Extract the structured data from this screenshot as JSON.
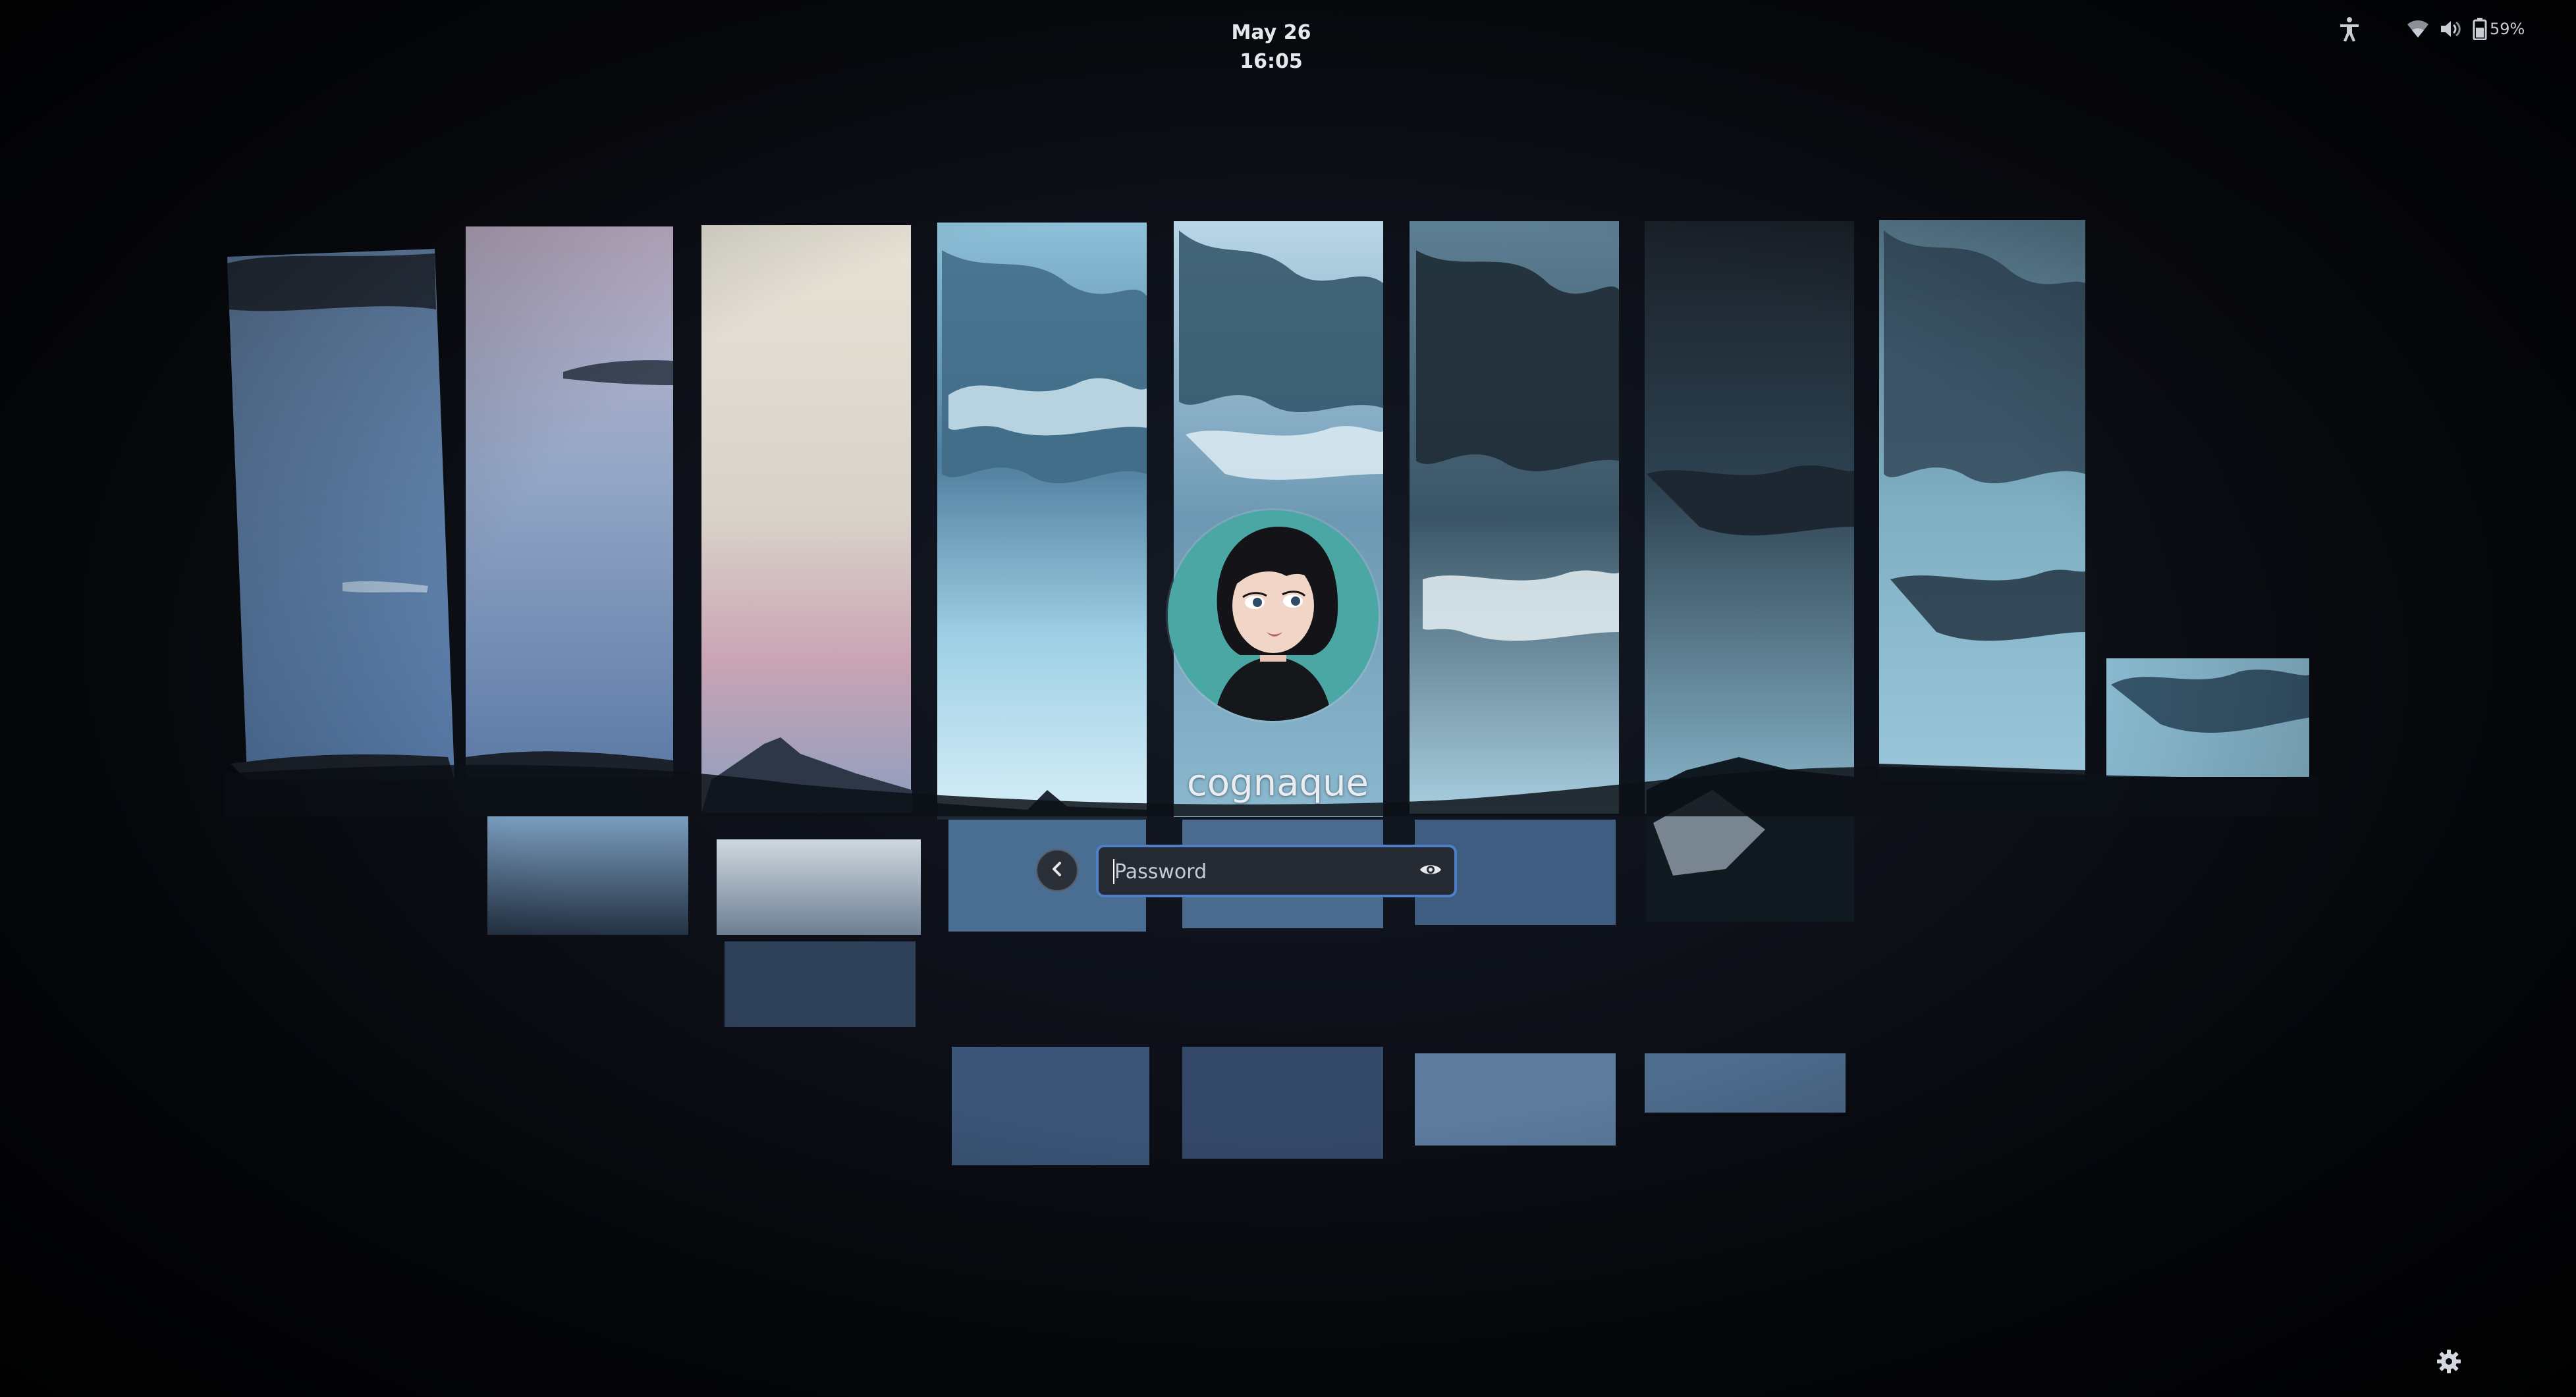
{
  "topbar": {
    "clock": "May 26  16:05",
    "battery_percent": "59%"
  },
  "login": {
    "username": "cognaque",
    "password_placeholder": "Password"
  },
  "icons": {
    "accessibility": "accessibility-icon",
    "wifi": "wifi-icon",
    "volume": "volume-icon",
    "battery": "battery-icon",
    "back": "chevron-left-icon",
    "reveal": "eye-icon",
    "settings": "gear-icon"
  },
  "colors": {
    "accent": "#4f7fc7",
    "avatar_bg": "#4aa7a4",
    "text": "#e9edf2",
    "background": "#05060a"
  }
}
